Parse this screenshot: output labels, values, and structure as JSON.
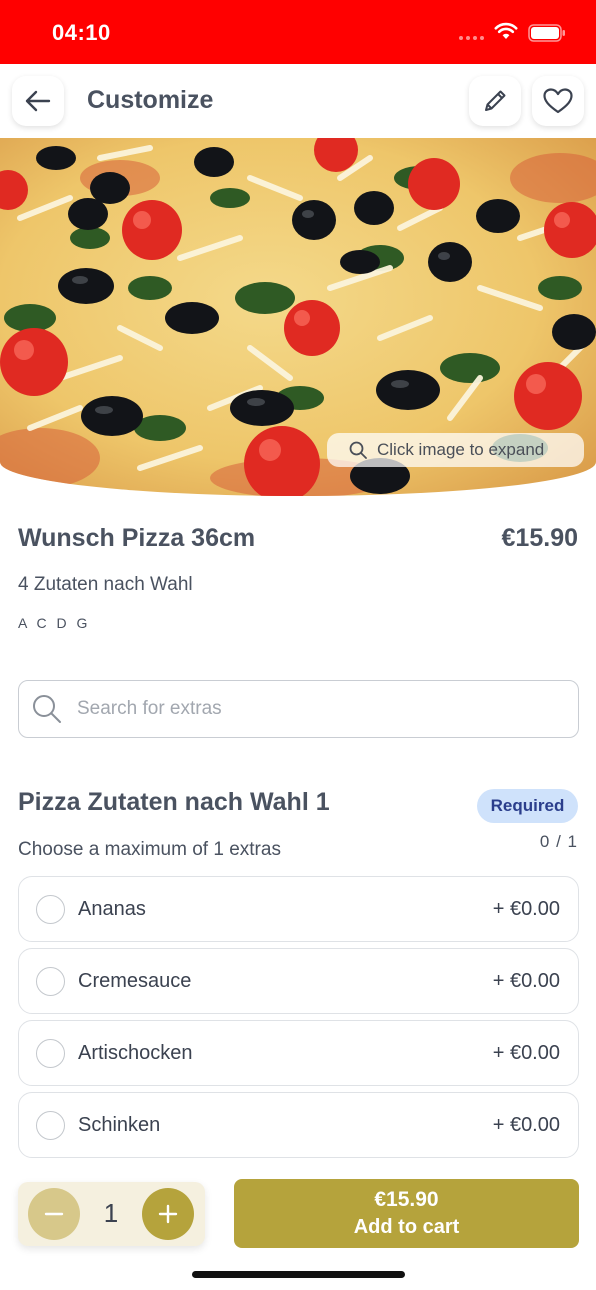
{
  "status_bar": {
    "time": "04:10"
  },
  "header": {
    "title": "Customize"
  },
  "hero": {
    "expand_hint": "Click image to expand"
  },
  "product": {
    "name": "Wunsch Pizza 36cm",
    "price": "€15.90",
    "description": "4 Zutaten nach Wahl",
    "allergens": "A C D G"
  },
  "search": {
    "placeholder": "Search for extras",
    "value": ""
  },
  "extras_group": {
    "title": "Pizza Zutaten nach Wahl 1",
    "badge": "Required",
    "hint": "Choose a maximum of 1 extras",
    "count": "0 / 1",
    "options": [
      {
        "label": "Ananas",
        "price": "+ €0.00"
      },
      {
        "label": "Cremesauce",
        "price": "+ €0.00"
      },
      {
        "label": "Artischocken",
        "price": "+ €0.00"
      },
      {
        "label": "Schinken",
        "price": "+ €0.00"
      }
    ]
  },
  "footer": {
    "quantity": "1",
    "cart_price": "€15.90",
    "cart_label": "Add to cart"
  },
  "colors": {
    "status_bar": "#ff0000",
    "accent": "#b5a33c",
    "accent_light": "#d7c88a",
    "badge_bg": "#cfe2fb",
    "badge_text": "#2b3e8c"
  },
  "icons": [
    "back-arrow-icon",
    "pencil-icon",
    "heart-icon",
    "search-icon",
    "minus-icon",
    "plus-icon",
    "wifi-icon",
    "battery-icon"
  ]
}
